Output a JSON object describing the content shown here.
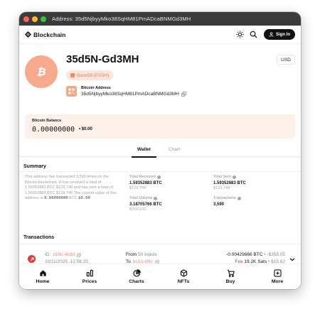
{
  "window": {
    "title": "Address: 35d5NjbyyMko38SqHM81PmADcaBNMGd3MH",
    "traffic_lights": [
      "#ff5f57",
      "#febc2e",
      "#28c840"
    ]
  },
  "header": {
    "brand": "Blockchain",
    "sign_in_label": "Sign In",
    "icons": [
      "theme-toggle-icon",
      "search-icon",
      "user-icon"
    ]
  },
  "address": {
    "title": "35d5N-Gd3MH",
    "badge": "Base58 (P2SH)",
    "label": "Bitcoin Address",
    "value": "35d5NjbyyMko38SqHM81PmADcaBNMGd3MH",
    "currency": "USD",
    "coin_symbol": "₿"
  },
  "balance": {
    "label": "Bitcoin Balance",
    "btc": "0.00000000",
    "usd": "• $0.00"
  },
  "tabs": [
    {
      "label": "Wallet",
      "active": true
    },
    {
      "label": "Chart",
      "active": false
    }
  ],
  "summary": {
    "title": "Summary",
    "text_before": "This address has transacted 3,590 times on the Bitcoin blockchain. It has received a total of 1.59352883 BTC $129,746 and has sent a total of 1.59352883 BTC $129,746 The current value of this address is ",
    "text_value": "0.00000000",
    "text_mid": " BTC ",
    "text_usd": "$0.00",
    "stats": {
      "total_received": {
        "label": "Total Received",
        "value": "1.59352883 BTC",
        "sub": "$129,746"
      },
      "total_sent": {
        "label": "Total Sent",
        "value": "1.59352883 BTC",
        "sub": "$129,746"
      },
      "total_volume": {
        "label": "Total Volume",
        "value": "3.18705766 BTC",
        "sub": "$259,532"
      },
      "transactions": {
        "label": "Transactions",
        "value": "3,590"
      }
    }
  },
  "transactions": {
    "title": "Transactions",
    "rows": [
      {
        "id_label": "ID:",
        "id": "d16c-4b3d",
        "date": "10/11/2025, 12:56:25",
        "from_label": "From",
        "from": "50 Inputs",
        "to_label": "To",
        "to": "bc1q-y9tz",
        "amount": "-0.00429866 BTC",
        "amount_usd": "• -$358.05",
        "fee_label": "Fee",
        "fee": "19.2K Sats",
        "fee_usd": "• $15.62"
      }
    ]
  },
  "bottom_nav": [
    {
      "label": "Home",
      "icon": "home-icon"
    },
    {
      "label": "Prices",
      "icon": "prices-icon"
    },
    {
      "label": "Charts",
      "icon": "charts-icon"
    },
    {
      "label": "NFTs",
      "icon": "nfts-icon"
    },
    {
      "label": "Buy",
      "icon": "buy-icon"
    },
    {
      "label": "More",
      "icon": "more-icon"
    }
  ]
}
